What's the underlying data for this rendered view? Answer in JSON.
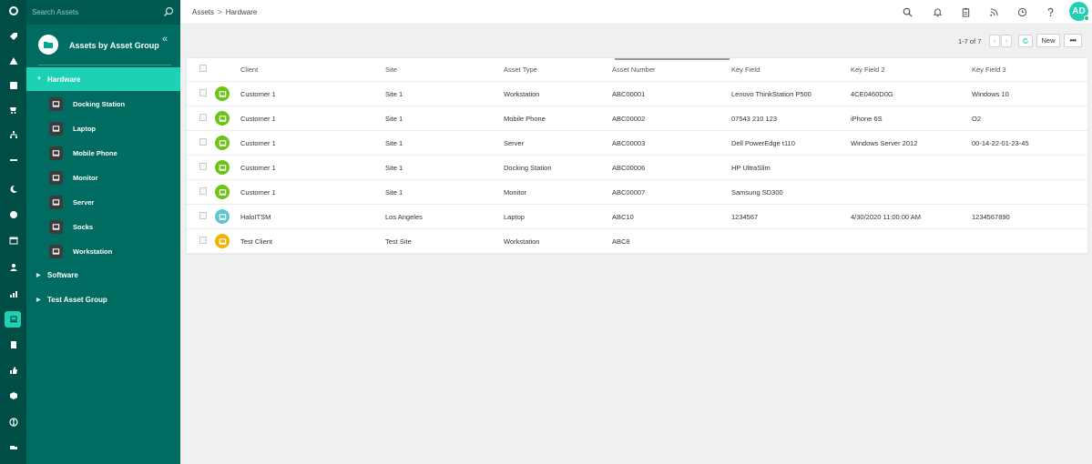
{
  "search": {
    "placeholder": "Search Assets"
  },
  "group": {
    "title": "Assets by Asset Group",
    "collapse": "«"
  },
  "tree": {
    "roots": [
      {
        "label": "Hardware",
        "active": true
      },
      {
        "label": "Software",
        "active": false
      },
      {
        "label": "Test Asset Group",
        "active": false
      }
    ],
    "children": [
      "Docking Station",
      "Laptop",
      "Mobile Phone",
      "Monitor",
      "Server",
      "Socks",
      "Workstation"
    ]
  },
  "breadcrumb": {
    "root": "Assets",
    "sep": ">",
    "current": "Hardware"
  },
  "user": {
    "initials": "AD"
  },
  "pager": {
    "text": "1-7 of 7",
    "new_label": "New",
    "more_label": "•••"
  },
  "colors": {
    "accent": "#1fd1b4",
    "green": "#6cc417",
    "teal": "#5dc6cf",
    "orange": "#f5b200"
  },
  "table": {
    "columns": [
      "Client",
      "Site",
      "Asset Type",
      "Asset Number",
      "Key Field",
      "Key Field 2",
      "Key Field 3"
    ],
    "rows": [
      {
        "color": "#6cc417",
        "cells": [
          "Customer 1",
          "Site 1",
          "Workstation",
          "ABC00001",
          "Lenovo ThinkStation P500",
          "4CE0460D0G",
          "Windows 10"
        ]
      },
      {
        "color": "#6cc417",
        "cells": [
          "Customer 1",
          "Site 1",
          "Mobile Phone",
          "ABC00002",
          "07543 210 123",
          "iPhone 6S",
          "O2"
        ]
      },
      {
        "color": "#6cc417",
        "cells": [
          "Customer 1",
          "Site 1",
          "Server",
          "ABC00003",
          "Dell PowerEdge t110",
          "Windows Server 2012",
          "00-14-22-01-23-45"
        ]
      },
      {
        "color": "#6cc417",
        "cells": [
          "Customer 1",
          "Site 1",
          "Docking Station",
          "ABC00006",
          "HP UltraSlim",
          "",
          ""
        ]
      },
      {
        "color": "#6cc417",
        "cells": [
          "Customer 1",
          "Site 1",
          "Monitor",
          "ABC00007",
          "Samsung SD300",
          "",
          ""
        ]
      },
      {
        "color": "#5dc6cf",
        "cells": [
          "HaloITSM",
          "Los Angeles",
          "Laptop",
          "ABC10",
          "1234567",
          "4/30/2020 11:00:00 AM",
          "1234567890"
        ]
      },
      {
        "color": "#f5b200",
        "cells": [
          "Test Client",
          "Test Site",
          "Workstation",
          "ABC8",
          "",
          "",
          ""
        ]
      }
    ]
  }
}
